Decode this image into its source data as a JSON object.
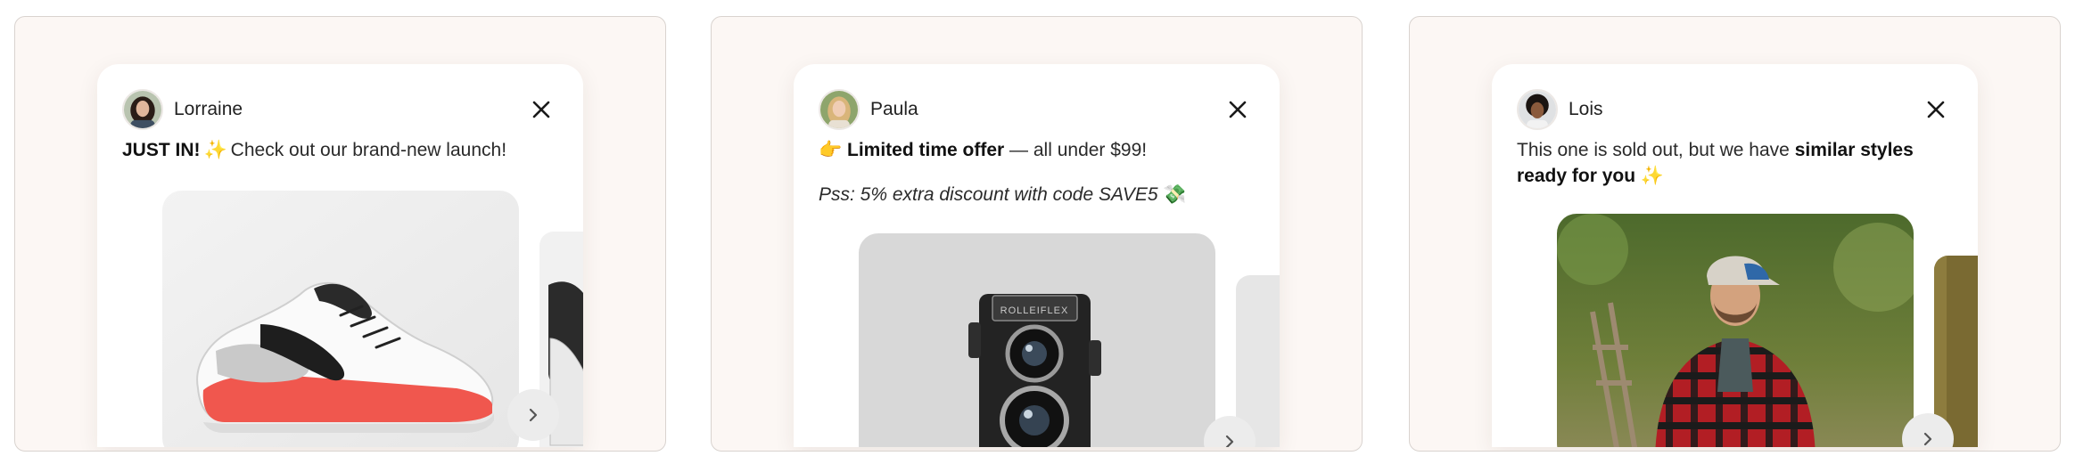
{
  "cards": [
    {
      "author": "Lorraine",
      "message_bold": "JUST IN!",
      "message_emoji": "✨",
      "message_text": "Check out our brand-new launch!",
      "product_image": "red-white-sneaker-image",
      "next_icon": "chevron-right-icon"
    },
    {
      "author": "Paula",
      "message_emoji": "👉",
      "message_bold": "Limited time offer",
      "message_text": "— all under $99!",
      "promo_text": "Pss: 5% extra discount with code SAVE5",
      "promo_emoji": "💸",
      "product_image": "vintage-camera-image",
      "camera_brand": "ROLLEIFLEX"
    },
    {
      "author": "Lois",
      "message_text": "This one is sold out, but we have",
      "message_bold_1": "similar styles",
      "message_bold_2": "ready for you",
      "message_emoji": "✨",
      "product_image": "man-in-plaid-shirt-image",
      "next_icon": "chevron-right-icon"
    }
  ],
  "colors": {
    "panel_bg": "#fcf7f4",
    "card_bg": "#ffffff",
    "sneaker_accent": "#f0574e"
  }
}
